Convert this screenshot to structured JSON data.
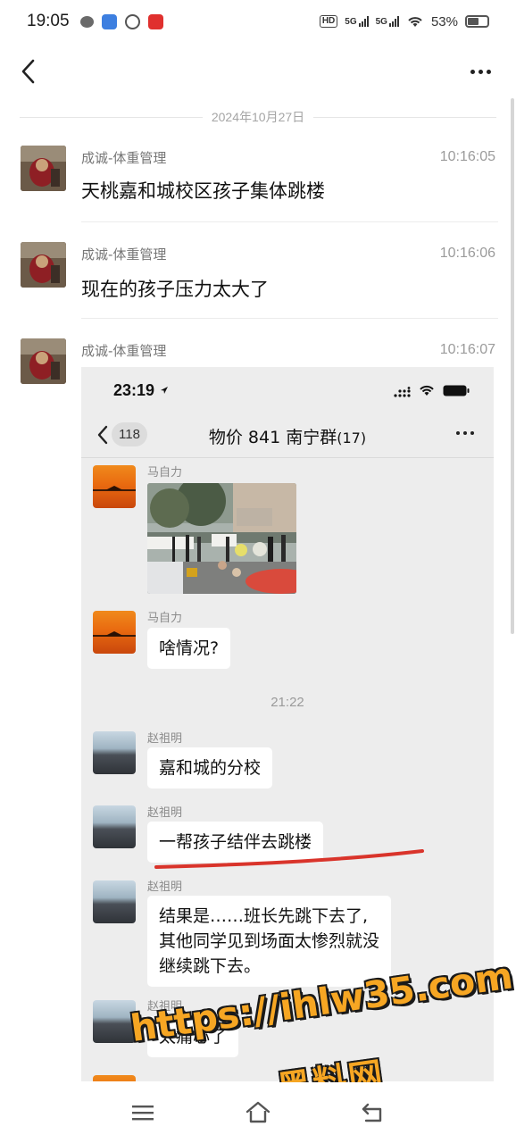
{
  "status_bar": {
    "time": "19:05",
    "network_1": "5G",
    "network_2": "5G",
    "hd_label": "HD",
    "battery": "53%",
    "battery_level": 0.53
  },
  "header": {
    "back_icon": "chevron-left-icon",
    "more_icon": "more-horizontal-icon"
  },
  "date_separator": "2024年10月27日",
  "messages": [
    {
      "sender": "成诚-体重管理",
      "time": "10:16:05",
      "text": "天桃嘉和城校区孩子集体跳楼"
    },
    {
      "sender": "成诚-体重管理",
      "time": "10:16:06",
      "text": "现在的孩子压力太大了"
    },
    {
      "sender": "成诚-体重管理",
      "time": "10:16:07"
    }
  ],
  "embedded_screenshot": {
    "time": "23:19",
    "back_count": "118",
    "group_title": "物价 841 南宁群",
    "member_count": "(17)",
    "time_divider": "21:22",
    "chat": [
      {
        "name": "马自力",
        "type": "image"
      },
      {
        "name": "马自力",
        "text": "啥情况?"
      },
      {
        "name": "赵祖明",
        "text": "嘉和城的分校"
      },
      {
        "name": "赵祖明",
        "text": "一帮孩子结伴去跳楼"
      },
      {
        "name": "赵祖明",
        "lines": [
          "结果是……班长先跳下去了,",
          "其他同学见到场面太惨烈就没",
          "继续跳下去。"
        ]
      },
      {
        "name": "赵祖明",
        "text": "太痛心了"
      }
    ],
    "underline_color": "#d9342b"
  },
  "watermark": {
    "url": "https://ihlw35.com",
    "name": "黑料网",
    "color": "#f6a623"
  },
  "navbar": {
    "menu_icon": "menu-icon",
    "home_icon": "home-icon",
    "back_icon": "return-icon"
  }
}
